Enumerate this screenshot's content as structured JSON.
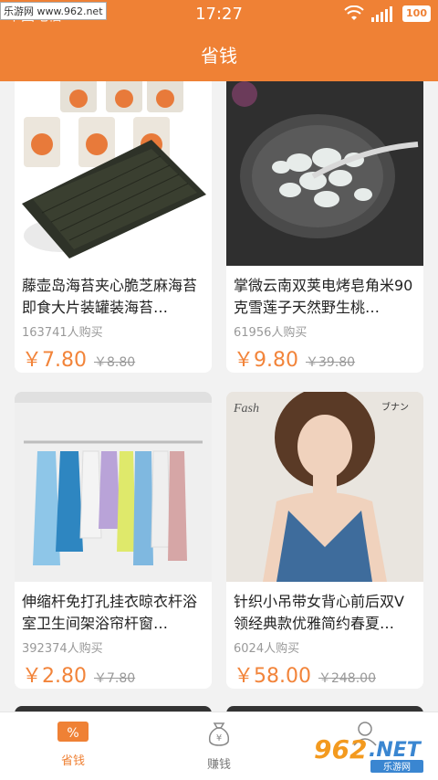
{
  "status": {
    "carrier": "中国电信",
    "time": "17:27",
    "battery": "100",
    "watermark": "乐游网 www.962.net"
  },
  "header": {
    "title": "省钱"
  },
  "products": [
    {
      "title": "藤壶岛海苔夹心脆芝麻海苔即食大片装罐装海苔…",
      "sold": "163741人购买",
      "price": "￥7.80",
      "old_price": "￥8.80"
    },
    {
      "title": "掌微云南双荚电烤皂角米90克雪莲子天然野生桃…",
      "sold": "61956人购买",
      "price": "￥9.80",
      "old_price": "￥39.80"
    },
    {
      "title": "伸缩杆免打孔挂衣晾衣杆浴室卫生间架浴帘杆窗…",
      "sold": "392374人购买",
      "price": "￥2.80",
      "old_price": "￥7.80"
    },
    {
      "title": "针织小吊带女背心前后双V领经典款优雅简约春夏…",
      "sold": "6024人购买",
      "price": "￥58.00",
      "old_price": "￥248.00"
    }
  ],
  "tabs": [
    {
      "label": "省钱",
      "icon": "percent-coupon-icon",
      "active": true
    },
    {
      "label": "赚钱",
      "icon": "money-bag-icon",
      "active": false
    },
    {
      "label": "",
      "icon": "profile-icon",
      "active": false
    }
  ],
  "colors": {
    "brand": "#ef8135",
    "price": "#f2843a"
  },
  "overlay_logo": {
    "text": "962.NET",
    "subtext": "乐游网"
  }
}
